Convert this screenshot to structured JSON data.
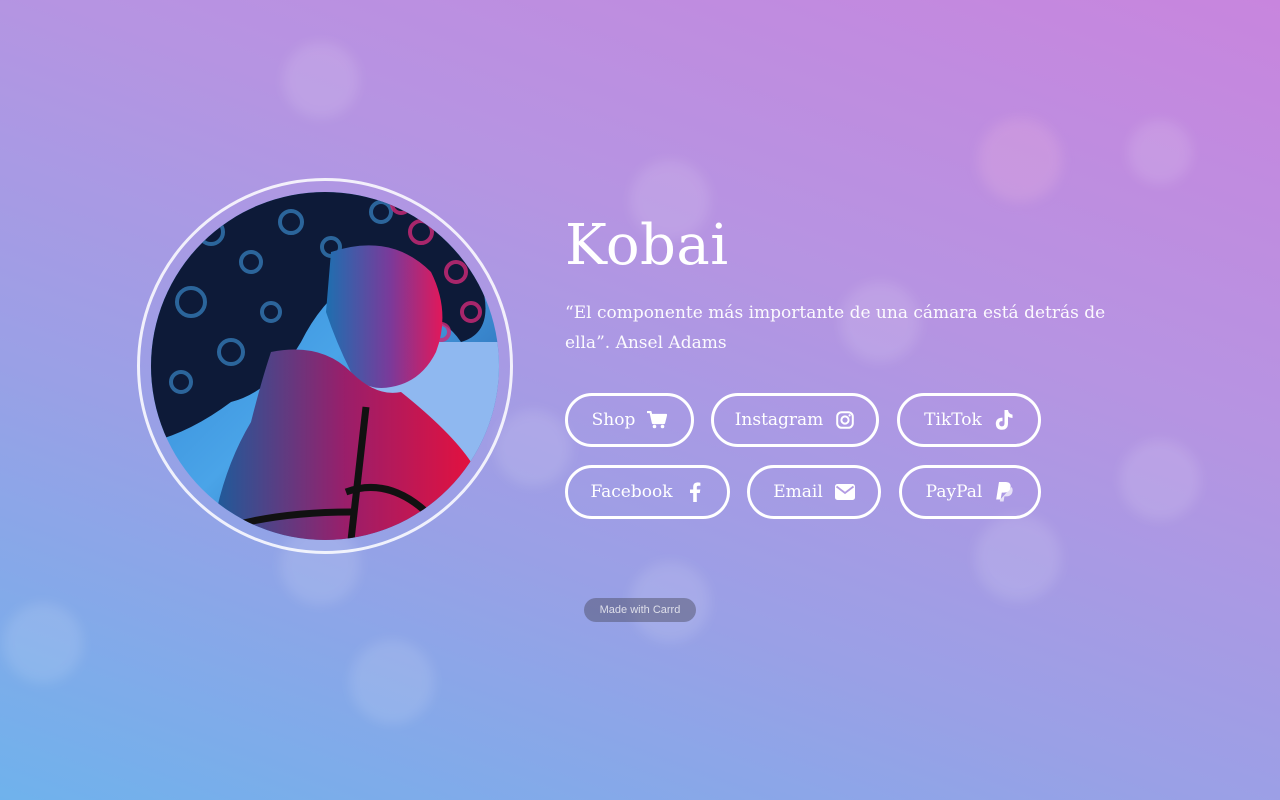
{
  "profile": {
    "name": "Kobai",
    "quote": "“El componente más importante de una cámara está detrás de ella”. Ansel Adams"
  },
  "buttons": [
    {
      "label": "Shop",
      "icon": "cart-icon"
    },
    {
      "label": "Instagram",
      "icon": "instagram-icon"
    },
    {
      "label": "TikTok",
      "icon": "tiktok-icon"
    },
    {
      "label": "Facebook",
      "icon": "facebook-icon"
    },
    {
      "label": "Email",
      "icon": "envelope-icon"
    },
    {
      "label": "PayPal",
      "icon": "paypal-icon"
    }
  ],
  "footer": {
    "made_with": "Made with Carrd"
  },
  "colors": {
    "gradient_top": "#c885de",
    "gradient_bottom": "#6fb2ec",
    "button_border": "#ffffff"
  }
}
